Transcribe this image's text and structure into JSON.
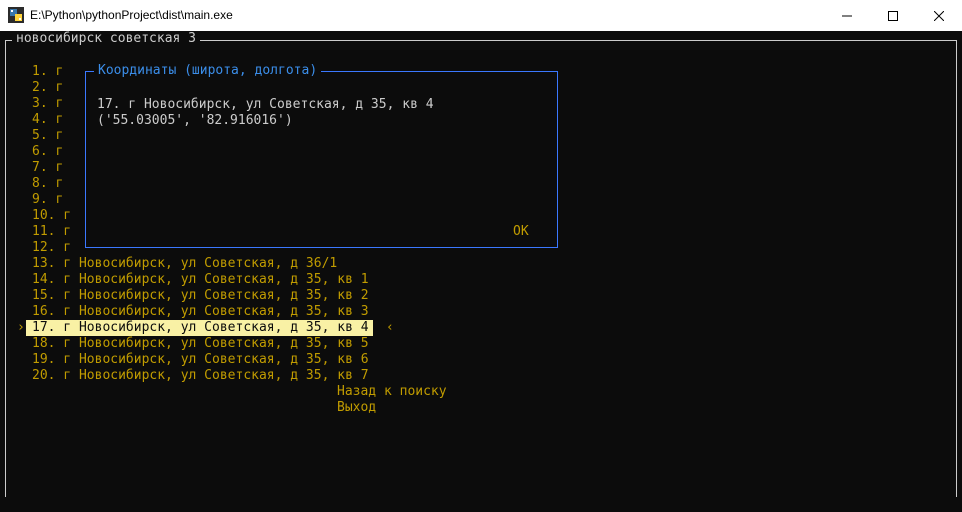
{
  "window": {
    "title": "E:\\Python\\pythonProject\\dist\\main.exe",
    "icon": "python-exe-icon",
    "buttons": [
      "minimize",
      "maximize",
      "close"
    ]
  },
  "app": {
    "search_title": "новосибирск советская 3",
    "results": [
      "1. г",
      "2. г",
      "3. г",
      "4. г",
      "5. г",
      "6. г",
      "7. г",
      "8. г",
      "9. г",
      "10. г",
      "11. г",
      "12. г",
      "13. г Новосибирск, ул Советская, д 36/1",
      "14. г Новосибирск, ул Советская, д 35, кв 1",
      "15. г Новосибирск, ул Советская, д 35, кв 2",
      "16. г Новосибирск, ул Советская, д 35, кв 3",
      "17. г Новосибирск, ул Советская, д 35, кв 4",
      "18. г Новосибирск, ул Советская, д 35, кв 5",
      "19. г Новосибирск, ул Советская, д 35, кв 6",
      "20. г Новосибирск, ул Советская, д 35, кв 7"
    ],
    "selected_result": "17. г Новосибирск, ул Советская, д 35, кв 4",
    "selected_index": 17,
    "actions": {
      "back": "Назад к поиску",
      "exit": "Выход"
    }
  },
  "dialog": {
    "title": "Координаты (широта, долгота)",
    "address": "17. г Новосибирск, ул Советская, д 35, кв 4",
    "coordinates": "('55.03005', '82.916016')",
    "ok_label": "OK"
  },
  "colors": {
    "console_bg": "#0c0c0c",
    "text_yellow": "#c19c00",
    "text_gray": "#cccccc",
    "highlight_bg": "#f9f1a5",
    "dialog_border": "#3b78ff",
    "dialog_title": "#3b8eea"
  }
}
